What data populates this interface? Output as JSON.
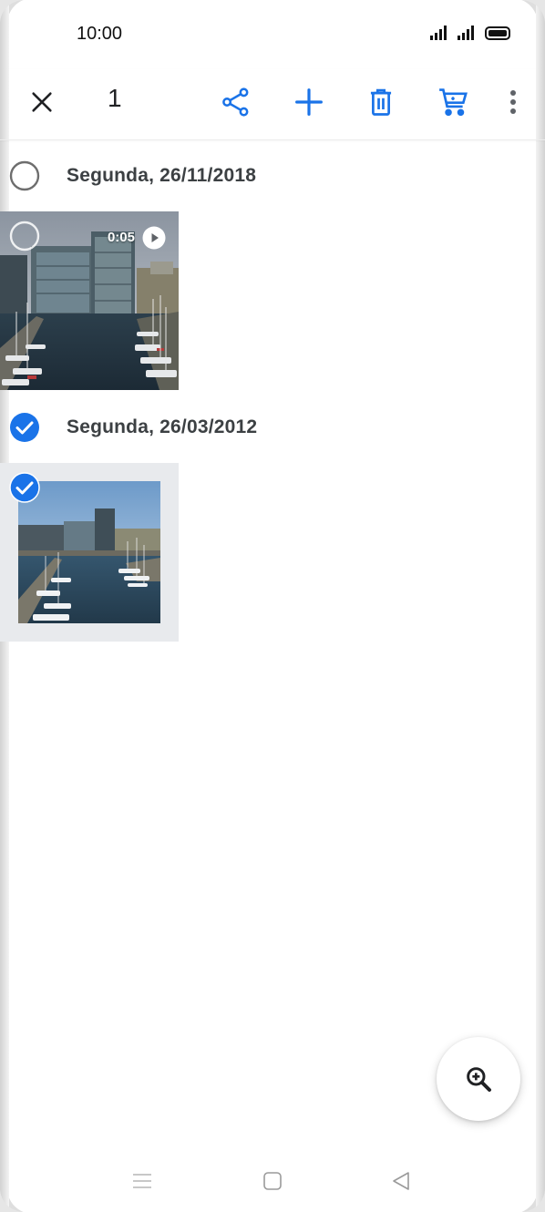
{
  "status_bar": {
    "time": "10:00",
    "icons": [
      "signal-icon",
      "signal-icon",
      "battery-icon"
    ]
  },
  "action_bar": {
    "close_icon": "close-icon",
    "selected_count": "1",
    "actions": [
      "share-icon",
      "add-icon",
      "delete-icon",
      "cart-icon",
      "more-vert-icon"
    ],
    "accent_color": "#1a73e8"
  },
  "sections": [
    {
      "date": "Segunda, 26/11/2018",
      "selected": false,
      "items": [
        {
          "type": "video",
          "duration": "0:05",
          "selected": false
        }
      ]
    },
    {
      "date": "Segunda, 26/03/2012",
      "selected": true,
      "items": [
        {
          "type": "photo",
          "selected": true
        }
      ]
    }
  ],
  "fab": {
    "icon": "zoom-in-icon"
  },
  "nav_bar": {
    "icons": [
      "menu-icon",
      "home-icon",
      "back-icon"
    ]
  }
}
